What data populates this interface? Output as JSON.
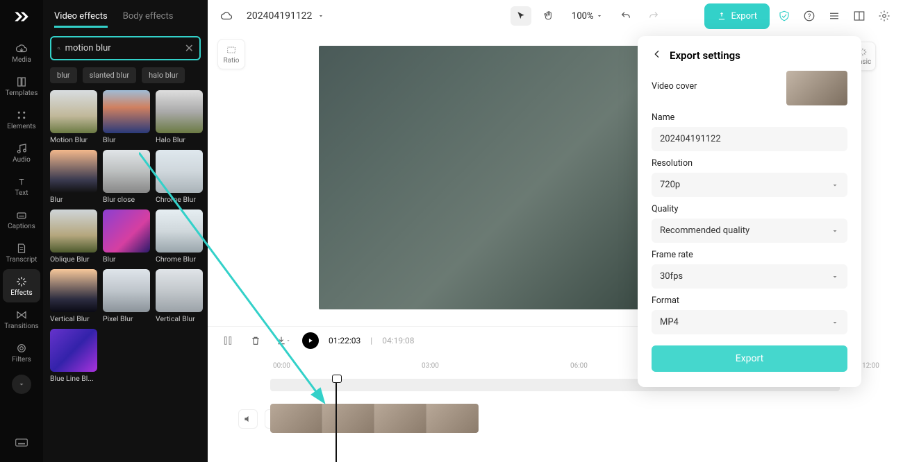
{
  "rail": {
    "items": [
      {
        "label": "Media"
      },
      {
        "label": "Templates"
      },
      {
        "label": "Elements"
      },
      {
        "label": "Audio"
      },
      {
        "label": "Text"
      },
      {
        "label": "Captions"
      },
      {
        "label": "Transcript"
      },
      {
        "label": "Effects"
      },
      {
        "label": "Transitions"
      },
      {
        "label": "Filters"
      }
    ],
    "active_index": 7
  },
  "panel": {
    "tabs": [
      {
        "label": "Video effects"
      },
      {
        "label": "Body effects"
      }
    ],
    "active_tab": 0,
    "search": {
      "placeholder": "Search",
      "value": "motion blur"
    },
    "chips": [
      "blur",
      "slanted blur",
      "halo blur"
    ],
    "effects": [
      {
        "label": "Motion Blur",
        "g": "g1"
      },
      {
        "label": "Blur",
        "g": "g2"
      },
      {
        "label": "Halo Blur",
        "g": "g3"
      },
      {
        "label": "Blur",
        "g": "g4"
      },
      {
        "label": "Blur close",
        "g": "g5"
      },
      {
        "label": "Chrome Blur",
        "g": "g6"
      },
      {
        "label": "Oblique Blur",
        "g": "g7"
      },
      {
        "label": "Blur",
        "g": "g8"
      },
      {
        "label": "Chrome Blur",
        "g": "g9"
      },
      {
        "label": "Vertical Blur",
        "g": "g10"
      },
      {
        "label": "Pixel Blur",
        "g": "g11"
      },
      {
        "label": "Vertical Blur",
        "g": "g12"
      },
      {
        "label": "Blue Line Bl...",
        "g": "g13"
      }
    ]
  },
  "header": {
    "project_name": "202404191122",
    "zoom": "100%",
    "export": "Export"
  },
  "canvas": {
    "ratio_label": "Ratio",
    "basic_label": "Basic"
  },
  "transport": {
    "current": "01:22:03",
    "sep": "|",
    "duration": "04:19:08"
  },
  "timeline": {
    "ticks": [
      "00:00",
      "03:00",
      "06:00",
      "12:00"
    ]
  },
  "export_panel": {
    "title": "Export settings",
    "cover_label": "Video cover",
    "name_label": "Name",
    "name_value": "202404191122",
    "resolution_label": "Resolution",
    "resolution_value": "720p",
    "quality_label": "Quality",
    "quality_value": "Recommended quality",
    "framerate_label": "Frame rate",
    "framerate_value": "30fps",
    "format_label": "Format",
    "format_value": "MP4",
    "export_btn": "Export"
  }
}
